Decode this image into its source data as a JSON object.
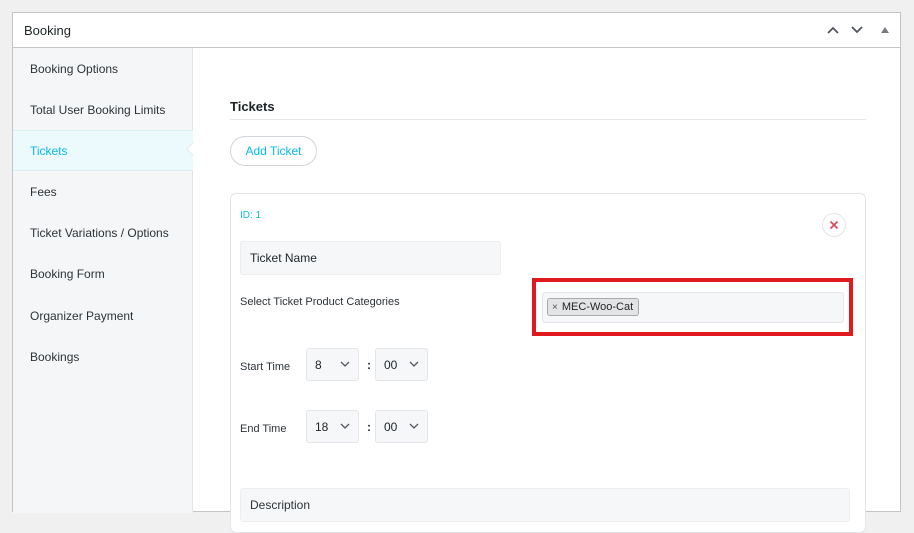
{
  "postbox": {
    "title": "Booking"
  },
  "sidebar": {
    "items": [
      {
        "label": "Booking Options",
        "active": false
      },
      {
        "label": "Total User Booking Limits",
        "active": false
      },
      {
        "label": "Tickets",
        "active": true
      },
      {
        "label": "Fees",
        "active": false
      },
      {
        "label": "Ticket Variations / Options",
        "active": false
      },
      {
        "label": "Booking Form",
        "active": false
      },
      {
        "label": "Organizer Payment",
        "active": false
      },
      {
        "label": "Bookings",
        "active": false
      }
    ]
  },
  "main": {
    "section_title": "Tickets",
    "add_ticket_label": "Add Ticket",
    "ticket": {
      "id_label": "ID: 1",
      "name_value": "Ticket Name",
      "categories_label": "Select Ticket Product Categories",
      "category_chip": "MEC-Woo-Cat",
      "chip_remove": "×",
      "start_label": "Start Time",
      "start_hour": "8",
      "start_minute": "00",
      "end_label": "End Time",
      "end_hour": "18",
      "end_minute": "00",
      "colon": ":",
      "description_placeholder": "Description"
    }
  },
  "colors": {
    "accent": "#07bbe9",
    "highlight": "#e0191f",
    "remove_icon": "#e0415a"
  }
}
